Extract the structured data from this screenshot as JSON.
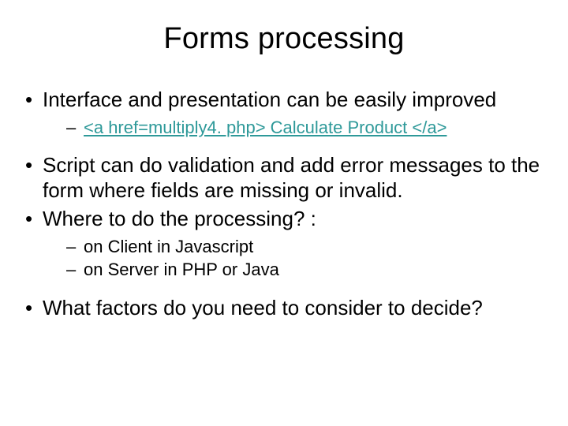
{
  "title": "Forms processing",
  "bullets": {
    "b1": "Interface and presentation can be easily improved",
    "b1_sub1": "<a href=multiply4. php> Calculate Product </a>",
    "b2": "Script can do validation and add error messages to the form where fields are missing or invalid.",
    "b3": "Where to do the processing? :",
    "b3_sub1": "on Client in Javascript",
    "b3_sub2": "on Server in PHP or Java",
    "b4": "What factors do you need to consider to decide?"
  }
}
